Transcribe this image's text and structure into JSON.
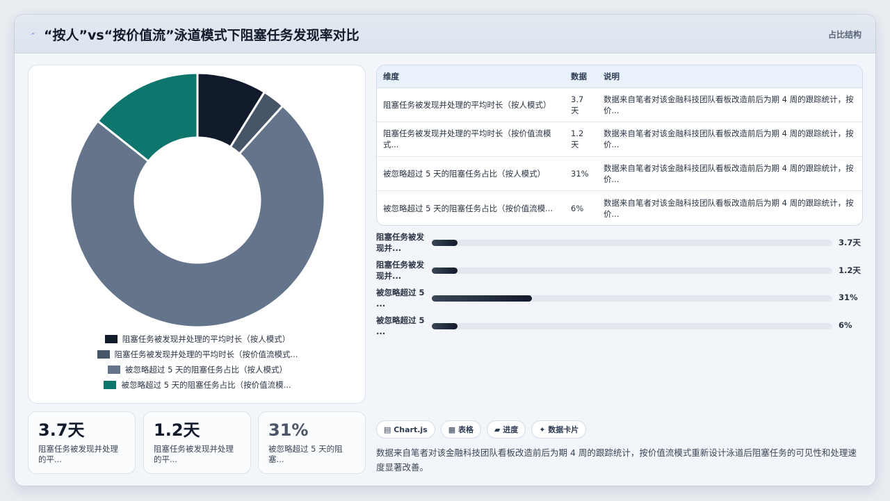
{
  "header": {
    "title": "“按人”vs“按价值流”泳道模式下阻塞任务发现率对比",
    "right_label": "占比结构"
  },
  "chart_data": {
    "type": "pie",
    "categories": [
      "阻塞任务被发现并处理的平均时长（按人模式）",
      "阻塞任务被发现并处理的平均时长（按价值流模式...",
      "被忽略超过 5 天的阻塞任务占比（按人模式）",
      "被忽略超过 5 天的阻塞任务占比（按价值流模..."
    ],
    "values": [
      3.7,
      1.2,
      31,
      6
    ],
    "colors": [
      "#111a2b",
      "#475569",
      "#64748b",
      "#0f766e"
    ],
    "legend_position": "bottom"
  },
  "stats": [
    {
      "value": "3.7天",
      "label": "阻塞任务被发现并处理的平..."
    },
    {
      "value": "1.2天",
      "label": "阻塞任务被发现并处理的平..."
    },
    {
      "value": "31%",
      "label": "被忽略超过 5 天的阻塞..."
    }
  ],
  "table": {
    "headers": [
      "维度",
      "数据",
      "说明"
    ],
    "rows": [
      [
        "阻塞任务被发现并处理的平均时长（按人模式）",
        "3.7天",
        "数据来自笔者对该金融科技团队看板改造前后为期 4 周的跟踪统计，按价..."
      ],
      [
        "阻塞任务被发现并处理的平均时长（按价值流模式...",
        "1.2天",
        "数据来自笔者对该金融科技团队看板改造前后为期 4 周的跟踪统计，按价..."
      ],
      [
        "被忽略超过 5 天的阻塞任务占比（按人模式）",
        "31%",
        "数据来自笔者对该金融科技团队看板改造前后为期 4 周的跟踪统计，按价..."
      ],
      [
        "被忽略超过 5 天的阻塞任务占比（按价值流模...",
        "6%",
        "数据来自笔者对该金融科技团队看板改造前后为期 4 周的跟踪统计，按价..."
      ]
    ]
  },
  "progress": [
    {
      "label": "阻塞任务被发现并...",
      "value_text": "3.7天",
      "fraction": 0.064
    },
    {
      "label": "阻塞任务被发现并...",
      "value_text": "1.2天",
      "fraction": 0.064
    },
    {
      "label": "被忽略超过 5 ...",
      "value_text": "31%",
      "fraction": 0.25
    },
    {
      "label": "被忽略超过 5 ...",
      "value_text": "6%",
      "fraction": 0.064
    }
  ],
  "chips": [
    "▤ Chart.js",
    "▦ 表格",
    "▰ 进度",
    "✦ 数据卡片"
  ],
  "note": "数据来自笔者对该金融科技团队看板改造前后为期 4 周的跟踪统计，按价值流模式重新设计泳道后阻塞任务的可见性和处理速度显著改善。"
}
